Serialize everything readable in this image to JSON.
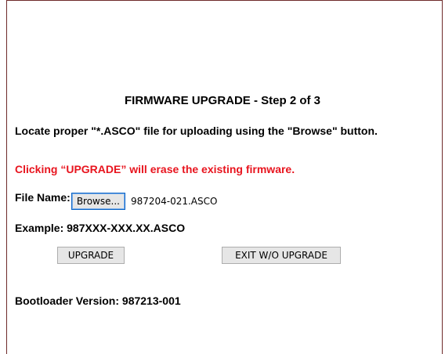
{
  "page": {
    "title": "FIRMWARE UPGRADE - Step 2 of 3",
    "instruction": "Locate proper \"*.ASCO\" file for uploading using the \"Browse\" button.",
    "warning": "Clicking “UPGRADE” will erase the existing firmware.",
    "warning_color": "#e8141e"
  },
  "file_input": {
    "label": "File Name:",
    "browse_label": "Browse...",
    "selected_file": "987204-021.ASCO"
  },
  "example": "Example: 987XXX-XXX.XX.ASCO",
  "actions": {
    "upgrade_label": "UPGRADE",
    "exit_label": "EXIT W/O UPGRADE"
  },
  "footer": {
    "bootloader_version": "Bootloader Version: 987213-001"
  }
}
